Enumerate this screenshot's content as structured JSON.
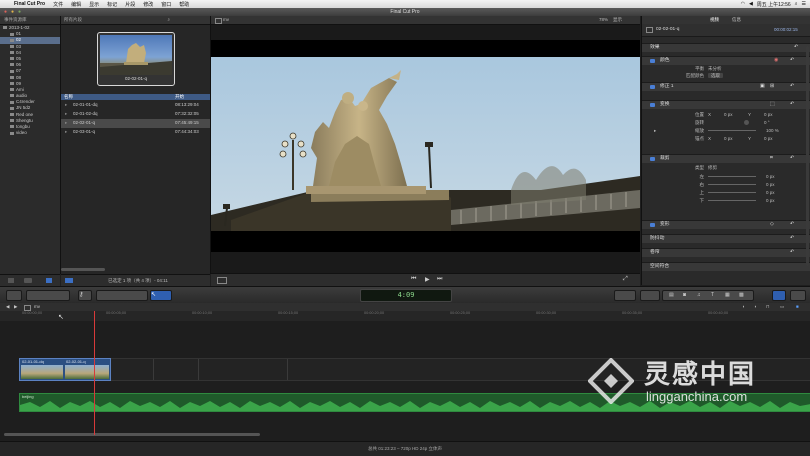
{
  "menubar": {
    "app_name": "Final Cut Pro",
    "items": [
      "文件",
      "编辑",
      "显示",
      "标记",
      "片段",
      "修改",
      "窗口",
      "帮助"
    ],
    "clock": "周五 上午12:56"
  },
  "window": {
    "title": "Final Cut Pro"
  },
  "library": {
    "header": "事件资源库",
    "items": [
      {
        "label": "2013-1-02",
        "level": 0,
        "selected": false
      },
      {
        "label": "01",
        "level": 1,
        "selected": false
      },
      {
        "label": "02",
        "level": 1,
        "selected": true
      },
      {
        "label": "03",
        "level": 1,
        "selected": false
      },
      {
        "label": "04",
        "level": 1,
        "selected": false
      },
      {
        "label": "05",
        "level": 1,
        "selected": false
      },
      {
        "label": "06",
        "level": 1,
        "selected": false
      },
      {
        "label": "07",
        "level": 1,
        "selected": false
      },
      {
        "label": "08",
        "level": 1,
        "selected": false
      },
      {
        "label": "09",
        "level": 1,
        "selected": false
      },
      {
        "label": "Ami",
        "level": 1,
        "selected": false
      },
      {
        "label": "audio",
        "level": 1,
        "selected": false
      },
      {
        "label": "C4render",
        "level": 1,
        "selected": false
      },
      {
        "label": "JN 5d2",
        "level": 1,
        "selected": false
      },
      {
        "label": "Red one",
        "level": 1,
        "selected": false
      },
      {
        "label": "Shengtu",
        "level": 1,
        "selected": false
      },
      {
        "label": "tongbu",
        "level": 1,
        "selected": false
      },
      {
        "label": "video",
        "level": 1,
        "selected": false
      }
    ]
  },
  "browser": {
    "header": "所有片段",
    "thumb_label": "02-02-01-q",
    "col_name": "名称",
    "col_start": "开始",
    "rows": [
      {
        "name": "02-01-01-dq",
        "tc": "08:13:29:04",
        "selected": false
      },
      {
        "name": "02-01-02-dq",
        "tc": "07:32:32:05",
        "selected": false
      },
      {
        "name": "02-02-01-q",
        "tc": "07:45:49:15",
        "selected": true
      },
      {
        "name": "02-03-01-q",
        "tc": "07:44:34:03",
        "selected": false
      }
    ],
    "footer": "已选定 1 项（共 4 项）- 04:11"
  },
  "viewer": {
    "title": "mv",
    "zoom": "78%",
    "view_label": "显示"
  },
  "inspector": {
    "tabs": [
      "视频",
      "信息"
    ],
    "clip_name": "02-02-01-q",
    "clip_tc": "00:00:02:15",
    "effects": "效果",
    "sections": {
      "color": {
        "title": "颜色",
        "balance_label": "平衡",
        "balance_value": "未分析",
        "match_label": "匹配颜色",
        "match_btn": "选取"
      },
      "correction": {
        "title": "修正 1"
      },
      "transform": {
        "title": "变换",
        "position_label": "位置",
        "x_label": "X",
        "x_value": "0 px",
        "y_label": "Y",
        "y_value": "0 px",
        "rotation_label": "旋转",
        "rotation_value": "0 °",
        "scale_label": "缩放",
        "scale_value": "100 %",
        "anchor_label": "锚点",
        "anchor_x": "0 px",
        "anchor_y": "0 px"
      },
      "crop": {
        "title": "裁剪",
        "type_label": "类型",
        "type_value": "修剪",
        "left_label": "左",
        "left_value": "0 px",
        "right_label": "右",
        "right_value": "0 px",
        "top_label": "上",
        "top_value": "0 px",
        "bottom_label": "下",
        "bottom_value": "0 px"
      },
      "distort": {
        "title": "变形"
      },
      "stabilize": {
        "title": "防抖动"
      },
      "rolling": {
        "title": "卷帘"
      },
      "spatial": {
        "title": "空间符合"
      }
    }
  },
  "toolbar": {
    "timecode": "4:09"
  },
  "timeline": {
    "project": "mv",
    "ruler": [
      "00:00:00;00",
      "00:00:05;00",
      "00:00:10;00",
      "00:00:15;00",
      "00:00:20;00",
      "00:00:25;00",
      "00:00:30;00",
      "00:00:35;00",
      "00:00:40;00"
    ],
    "clips": [
      "02-01-01-dq",
      "02-02-01-q"
    ],
    "audio_label": "beijing"
  },
  "status": "总共 01:23:23 – 720p HD 24p 立体声",
  "watermark": {
    "cn": "灵感中国",
    "url": "lingganchina.com"
  },
  "colors": {
    "accent": "#4a7fd6",
    "audio": "#2f8a3f",
    "playhead": "#d83a3a",
    "selection": "#5a6e8c"
  }
}
